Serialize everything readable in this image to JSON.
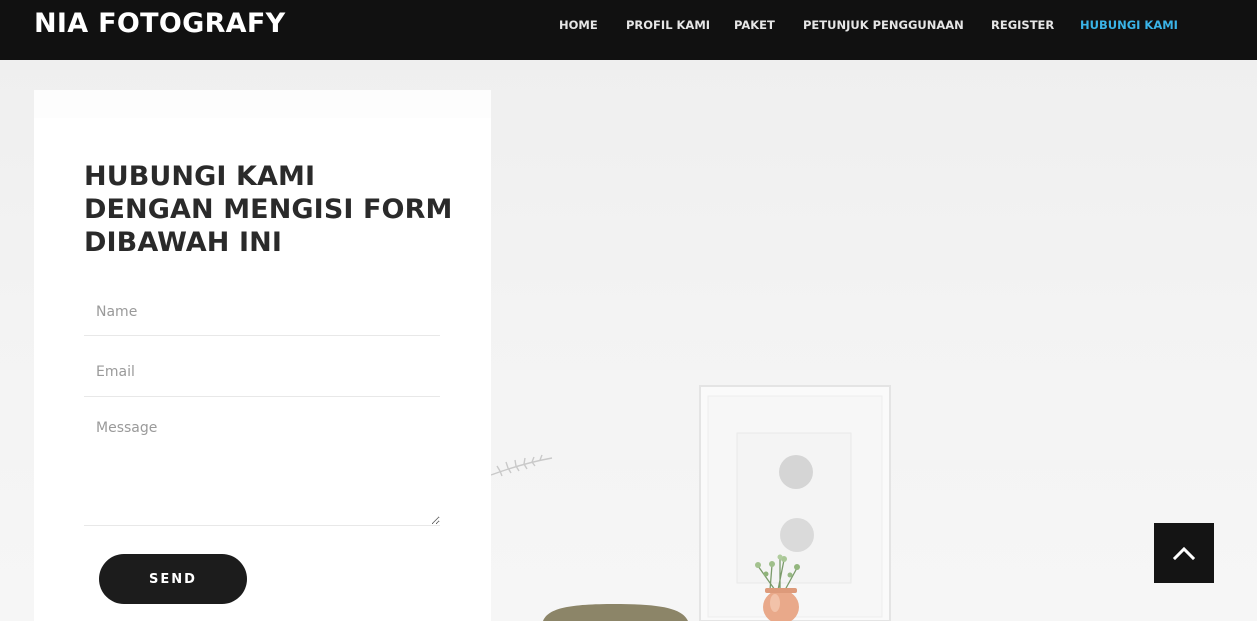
{
  "header": {
    "brand": "NIA FOTOGRAFY",
    "nav": [
      {
        "label": "HOME"
      },
      {
        "label": "PROFIL KAMI"
      },
      {
        "label": "PAKET"
      },
      {
        "label": "PETUNJUK PENGGUNAAN"
      },
      {
        "label": "REGISTER"
      },
      {
        "label": "HUBUNGI KAMI",
        "active": true
      }
    ]
  },
  "contact_form": {
    "title": "HUBUNGI KAMI DENGAN MENGISI FORM DIBAWAH INI",
    "name_placeholder": "Name",
    "email_placeholder": "Email",
    "message_placeholder": "Message",
    "send_label": "SEND"
  },
  "colors": {
    "nav_background": "#111111",
    "active_link": "#3ab4e8",
    "button": "#1c1c1c"
  },
  "icons": {
    "scroll_top": "chevron-up-icon"
  }
}
